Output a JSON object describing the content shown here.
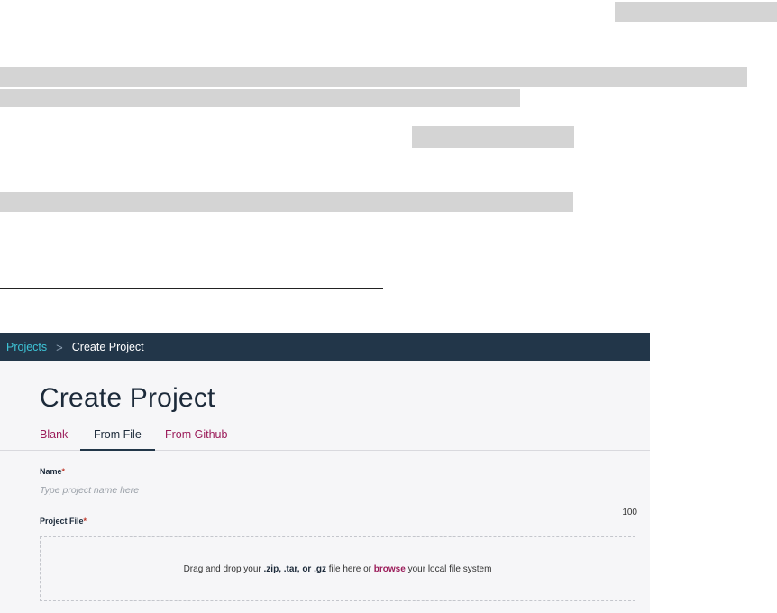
{
  "breadcrumb": {
    "root": "Projects",
    "separator": ">",
    "current": "Create Project"
  },
  "page": {
    "title": "Create Project"
  },
  "tabs": [
    {
      "label": "Blank"
    },
    {
      "label": "From File",
      "active": true
    },
    {
      "label": "From Github"
    }
  ],
  "form": {
    "name_label": "Name",
    "name_required": "*",
    "name_placeholder": "Type project name here",
    "name_counter": "100",
    "file_label": "Project File",
    "file_required": "*"
  },
  "dropzone": {
    "pre": "Drag and drop your ",
    "extensions": ".zip, .tar, or .gz",
    "mid": " file here or ",
    "browse": "browse",
    "post": " your local file system"
  },
  "colors": {
    "topbar": "#223649",
    "link_cyan": "#3ec4d6",
    "link_magenta": "#9b1c5a",
    "background": "#f6f6f8"
  }
}
